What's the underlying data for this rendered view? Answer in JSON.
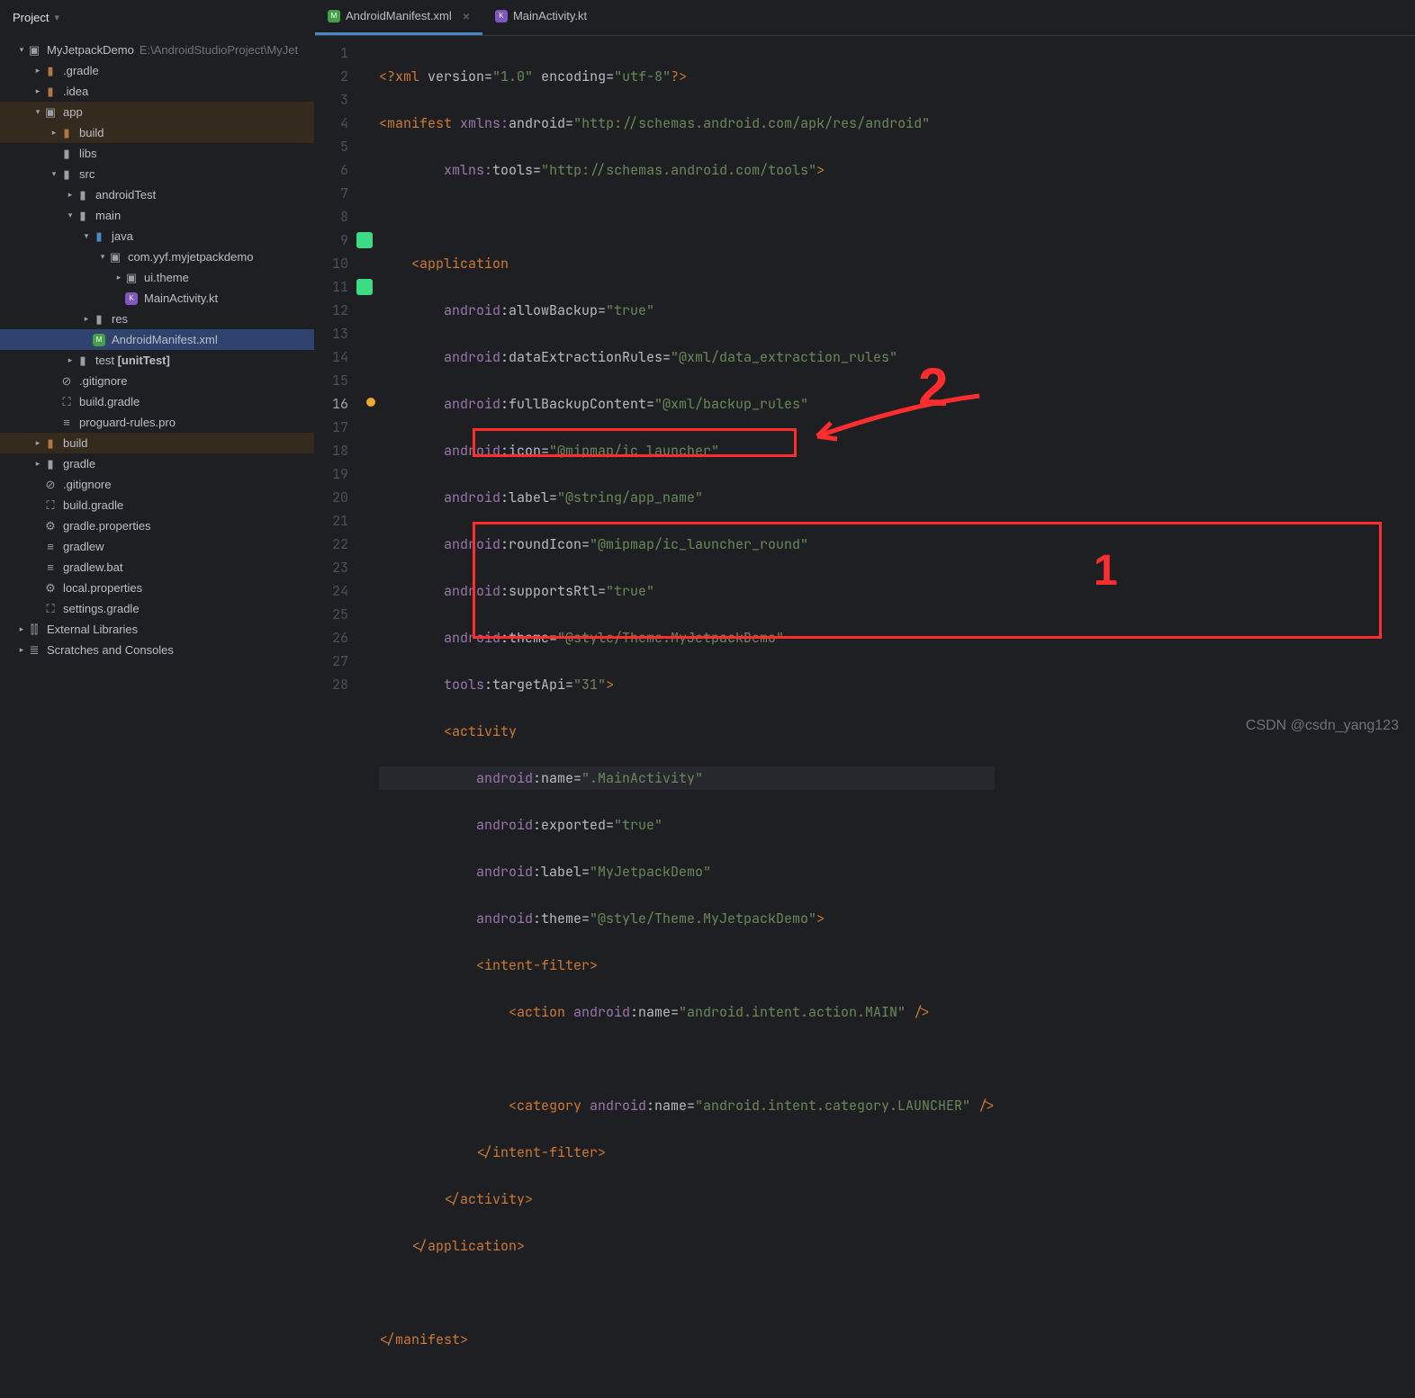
{
  "header": {
    "project_label": "Project"
  },
  "tree": {
    "root": {
      "name": "MyJetpackDemo",
      "path": "E:\\AndroidStudioProject\\MyJet"
    },
    "gradle_dir": ".gradle",
    "idea_dir": ".idea",
    "app_dir": "app",
    "build_dir": "build",
    "libs_dir": "libs",
    "src_dir": "src",
    "androidTest_dir": "androidTest",
    "main_dir": "main",
    "java_dir": "java",
    "pkg": "com.yyf.myjetpackdemo",
    "uitheme_dir": "ui.theme",
    "mainactivity": "MainActivity.kt",
    "res_dir": "res",
    "manifest": "AndroidManifest.xml",
    "test_dir_label": "test",
    "test_suffix": "[unitTest]",
    "gitignore": ".gitignore",
    "buildgradle": "build.gradle",
    "proguard": "proguard-rules.pro",
    "build2": "build",
    "gradle2": "gradle",
    "gradleprops": "gradle.properties",
    "gradlew": "gradlew",
    "gradlewbat": "gradlew.bat",
    "localprops": "local.properties",
    "settingsgradle": "settings.gradle",
    "extlibs": "External Libraries",
    "scratches": "Scratches and Consoles"
  },
  "tabs": {
    "manifest": "AndroidManifest.xml",
    "mainactivity": "MainActivity.kt"
  },
  "code": {
    "lines": {
      "l1_a": "<?xml ",
      "l1_b": "version",
      "l1_c": "=",
      "l1_d": "\"1.0\"",
      "l1_e": " encoding",
      "l1_f": "=",
      "l1_g": "\"utf-8\"",
      "l1_h": "?>",
      "l2_a": "<manifest ",
      "l2_b": "xmlns:",
      "l2_c": "android",
      "l2_d": "=",
      "l2_e": "\"http://schemas.android.com/apk/res/android\"",
      "l3_a": "        ",
      "l3_b": "xmlns:",
      "l3_c": "tools",
      "l3_d": "=",
      "l3_e": "\"http://schemas.android.com/tools\"",
      "l3_f": ">",
      "l5_a": "    <application",
      "l6_a": "        ",
      "l6_b": "android",
      "l6_c": ":allowBackup=",
      "l6_d": "\"true\"",
      "l7_a": "        ",
      "l7_b": "android",
      "l7_c": ":dataExtractionRules=",
      "l7_d": "\"@xml/data_extraction_rules\"",
      "l8_a": "        ",
      "l8_b": "android",
      "l8_c": ":fullBackupContent=",
      "l8_d": "\"@xml/backup_rules\"",
      "l9_a": "        ",
      "l9_b": "android",
      "l9_c": ":icon=",
      "l9_d": "\"@mipmap/ic_launcher\"",
      "l10_a": "        ",
      "l10_b": "android",
      "l10_c": ":label=",
      "l10_d": "\"@string/app_name\"",
      "l11_a": "        ",
      "l11_b": "android",
      "l11_c": ":roundIcon=",
      "l11_d": "\"@mipmap/ic_launcher_round\"",
      "l12_a": "        ",
      "l12_b": "android",
      "l12_c": ":supportsRtl=",
      "l12_d": "\"true\"",
      "l13_a": "        ",
      "l13_b": "android",
      "l13_c": ":theme=",
      "l13_d": "\"@style/Theme.MyJetpackDemo\"",
      "l14_a": "        ",
      "l14_b": "tools",
      "l14_c": ":targetApi=",
      "l14_d": "\"31\"",
      "l14_e": ">",
      "l15_a": "        <activity",
      "l16_a": "            ",
      "l16_b": "android",
      "l16_c": ":name=",
      "l16_d": "\".MainActivity\"",
      "l17_a": "            ",
      "l17_b": "android",
      "l17_c": ":exported=",
      "l17_d": "\"true\"",
      "l18_a": "            ",
      "l18_b": "android",
      "l18_c": ":label=",
      "l18_d": "\"MyJetpackDemo\"",
      "l19_a": "            ",
      "l19_b": "android",
      "l19_c": ":theme=",
      "l19_d": "\"@style/Theme.MyJetpackDemo\"",
      "l19_e": ">",
      "l20_a": "            <intent-filter>",
      "l21_a": "                <action ",
      "l21_b": "android",
      "l21_c": ":name=",
      "l21_d": "\"android.intent.action.MAIN\"",
      "l21_e": " />",
      "l23_a": "                <category ",
      "l23_b": "android",
      "l23_c": ":name=",
      "l23_d": "\"android.intent.category.LAUNCHER\"",
      "l23_e": " />",
      "l24_a": "            </intent-filter>",
      "l25_a": "        </activity>",
      "l26_a": "    </application>",
      "l28_a": "</manifest>"
    },
    "last_line": 28
  },
  "annotations": {
    "num1": "1",
    "num2": "2"
  },
  "watermark": "CSDN @csdn_yang123"
}
